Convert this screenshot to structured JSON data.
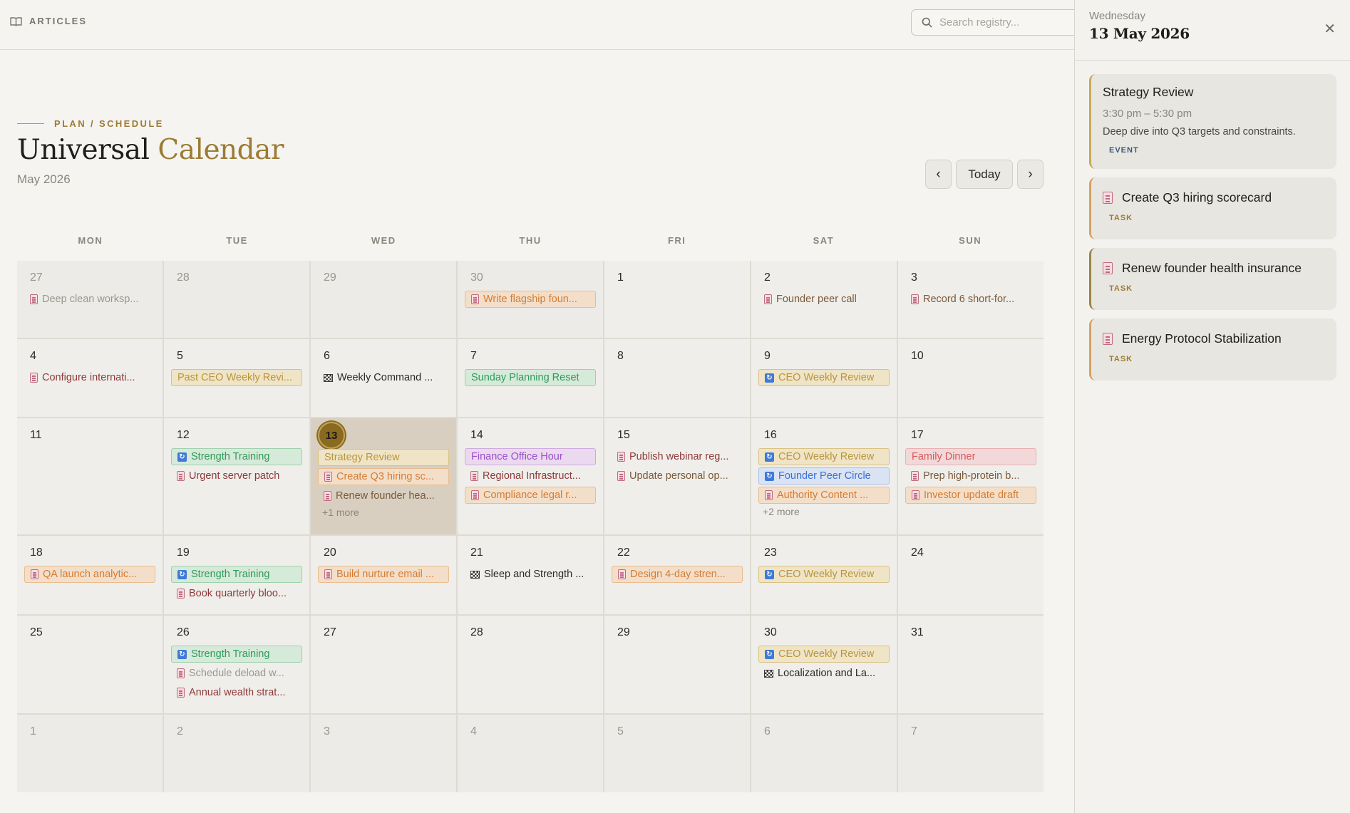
{
  "topbar": {
    "brand": "ARTICLES",
    "search_placeholder": "Search registry..."
  },
  "header": {
    "eyebrow": "PLAN / SCHEDULE",
    "title_main": "Universal",
    "title_accent": "Calendar",
    "month_label": "May 2026",
    "prev_glyph": "‹",
    "today_label": "Today",
    "next_glyph": "›"
  },
  "weekdays": [
    "MON",
    "TUE",
    "WED",
    "THU",
    "FRI",
    "SAT",
    "SUN"
  ],
  "event_colors": {
    "gold": {
      "text": "#b9953d",
      "bg": "#efe4c6",
      "border": "#d9c183"
    },
    "orange": {
      "text": "#d47c33",
      "bg": "#f3dfc9",
      "border": "#e8bc8e"
    },
    "green": {
      "text": "#2f9a5a",
      "bg": "#d6ead9",
      "border": "#9fd0ac"
    },
    "purple": {
      "text": "#9b4ec6",
      "bg": "#ead9ef",
      "border": "#cfa9de"
    },
    "blue": {
      "text": "#3f6fd1",
      "bg": "#d9e3f4",
      "border": "#a9c0e8"
    },
    "red": {
      "text": "#d8575c",
      "bg": "#f2d8d8",
      "border": "#e7b0b1"
    },
    "maroon_text": "#8e3a3a",
    "dark_text": "#2b2a27",
    "faded_text": "#9a968e"
  },
  "weeks": [
    [
      {
        "day": "27",
        "out": true,
        "events": [
          {
            "text": "Deep clean worksp...",
            "icon": "task",
            "style": "faded"
          }
        ]
      },
      {
        "day": "28",
        "out": true,
        "events": []
      },
      {
        "day": "29",
        "out": true,
        "events": []
      },
      {
        "day": "30",
        "out": true,
        "events": [
          {
            "text": "Write flagship foun...",
            "icon": "task",
            "style": "orange"
          }
        ]
      },
      {
        "day": "1",
        "events": []
      },
      {
        "day": "2",
        "events": [
          {
            "text": "Founder peer call",
            "icon": "task",
            "style": "brown"
          }
        ]
      },
      {
        "day": "3",
        "events": [
          {
            "text": "Record 6 short-for...",
            "icon": "task",
            "style": "brown"
          }
        ]
      }
    ],
    [
      {
        "day": "4",
        "events": [
          {
            "text": "Configure internati...",
            "icon": "task",
            "style": "maroon"
          }
        ]
      },
      {
        "day": "5",
        "events": [
          {
            "text": "Past CEO Weekly Revi...",
            "icon": "none",
            "style": "gold"
          }
        ]
      },
      {
        "day": "6",
        "events": [
          {
            "text": "Weekly Command ...",
            "icon": "flag",
            "style": "dark"
          }
        ]
      },
      {
        "day": "7",
        "events": [
          {
            "text": "Sunday Planning Reset",
            "icon": "none",
            "style": "green"
          }
        ]
      },
      {
        "day": "8",
        "events": []
      },
      {
        "day": "9",
        "events": [
          {
            "text": "CEO Weekly Review",
            "icon": "recur",
            "style": "gold"
          }
        ]
      },
      {
        "day": "10",
        "events": []
      }
    ],
    [
      {
        "day": "11",
        "events": []
      },
      {
        "day": "12",
        "events": [
          {
            "text": "Strength Training",
            "icon": "recur",
            "style": "green"
          },
          {
            "text": "Urgent server patch",
            "icon": "task",
            "style": "maroon"
          }
        ]
      },
      {
        "day": "13",
        "selected": true,
        "events": [
          {
            "text": "Strategy Review",
            "icon": "none",
            "style": "gold"
          },
          {
            "text": "Create Q3 hiring sc...",
            "icon": "task",
            "style": "orange"
          },
          {
            "text": "Renew founder hea...",
            "icon": "task",
            "style": "brown"
          }
        ],
        "more": "+1 more"
      },
      {
        "day": "14",
        "events": [
          {
            "text": "Finance Office Hour",
            "icon": "none",
            "style": "purple"
          },
          {
            "text": "Regional Infrastruct...",
            "icon": "task",
            "style": "maroon"
          },
          {
            "text": "Compliance legal r...",
            "icon": "task",
            "style": "orange"
          }
        ]
      },
      {
        "day": "15",
        "events": [
          {
            "text": "Publish webinar reg...",
            "icon": "task",
            "style": "maroon"
          },
          {
            "text": "Update personal op...",
            "icon": "task",
            "style": "brown"
          }
        ]
      },
      {
        "day": "16",
        "events": [
          {
            "text": "CEO Weekly Review",
            "icon": "recur",
            "style": "gold"
          },
          {
            "text": "Founder Peer Circle",
            "icon": "recur",
            "style": "blue"
          },
          {
            "text": "Authority Content ...",
            "icon": "task",
            "style": "orange"
          }
        ],
        "more": "+2 more"
      },
      {
        "day": "17",
        "events": [
          {
            "text": "Family Dinner",
            "icon": "none",
            "style": "red"
          },
          {
            "text": "Prep high-protein b...",
            "icon": "task",
            "style": "brown"
          },
          {
            "text": "Investor update draft",
            "icon": "task",
            "style": "orange"
          }
        ]
      }
    ],
    [
      {
        "day": "18",
        "events": [
          {
            "text": "QA launch analytic...",
            "icon": "task",
            "style": "orange"
          }
        ]
      },
      {
        "day": "19",
        "events": [
          {
            "text": "Strength Training",
            "icon": "recur",
            "style": "green"
          },
          {
            "text": "Book quarterly bloo...",
            "icon": "task",
            "style": "maroon"
          }
        ]
      },
      {
        "day": "20",
        "events": [
          {
            "text": "Build nurture email ...",
            "icon": "task",
            "style": "orange"
          }
        ]
      },
      {
        "day": "21",
        "events": [
          {
            "text": "Sleep and Strength ...",
            "icon": "flag",
            "style": "dark"
          }
        ]
      },
      {
        "day": "22",
        "events": [
          {
            "text": "Design 4-day stren...",
            "icon": "task",
            "style": "orange"
          }
        ]
      },
      {
        "day": "23",
        "events": [
          {
            "text": "CEO Weekly Review",
            "icon": "recur",
            "style": "gold"
          }
        ]
      },
      {
        "day": "24",
        "events": []
      }
    ],
    [
      {
        "day": "25",
        "events": []
      },
      {
        "day": "26",
        "events": [
          {
            "text": "Strength Training",
            "icon": "recur",
            "style": "green"
          },
          {
            "text": "Schedule deload w...",
            "icon": "task",
            "style": "faded"
          },
          {
            "text": "Annual wealth strat...",
            "icon": "task",
            "style": "maroon"
          }
        ]
      },
      {
        "day": "27",
        "events": []
      },
      {
        "day": "28",
        "events": []
      },
      {
        "day": "29",
        "events": []
      },
      {
        "day": "30",
        "events": [
          {
            "text": "CEO Weekly Review",
            "icon": "recur",
            "style": "gold"
          },
          {
            "text": "Localization and La...",
            "icon": "flag",
            "style": "dark"
          }
        ]
      },
      {
        "day": "31",
        "events": []
      }
    ],
    [
      {
        "day": "1",
        "out": true,
        "events": []
      },
      {
        "day": "2",
        "out": true,
        "events": []
      },
      {
        "day": "3",
        "out": true,
        "events": []
      },
      {
        "day": "4",
        "out": true,
        "events": []
      },
      {
        "day": "5",
        "out": true,
        "events": []
      },
      {
        "day": "6",
        "out": true,
        "events": []
      },
      {
        "day": "7",
        "out": true,
        "events": []
      }
    ]
  ],
  "panel": {
    "weekday": "Wednesday",
    "date": "13 May 2026",
    "close_glyph": "✕",
    "event_card": {
      "title": "Strategy Review",
      "time": "3:30 pm – 5:30 pm",
      "description": "Deep dive into Q3 targets and constraints.",
      "type": "EVENT"
    },
    "tasks": [
      {
        "title": "Create Q3 hiring scorecard",
        "type": "TASK",
        "accent": "orange"
      },
      {
        "title": "Renew founder health insurance",
        "type": "TASK",
        "accent": "olive"
      },
      {
        "title": "Energy Protocol Stabilization",
        "type": "TASK",
        "accent": "orange"
      }
    ]
  }
}
